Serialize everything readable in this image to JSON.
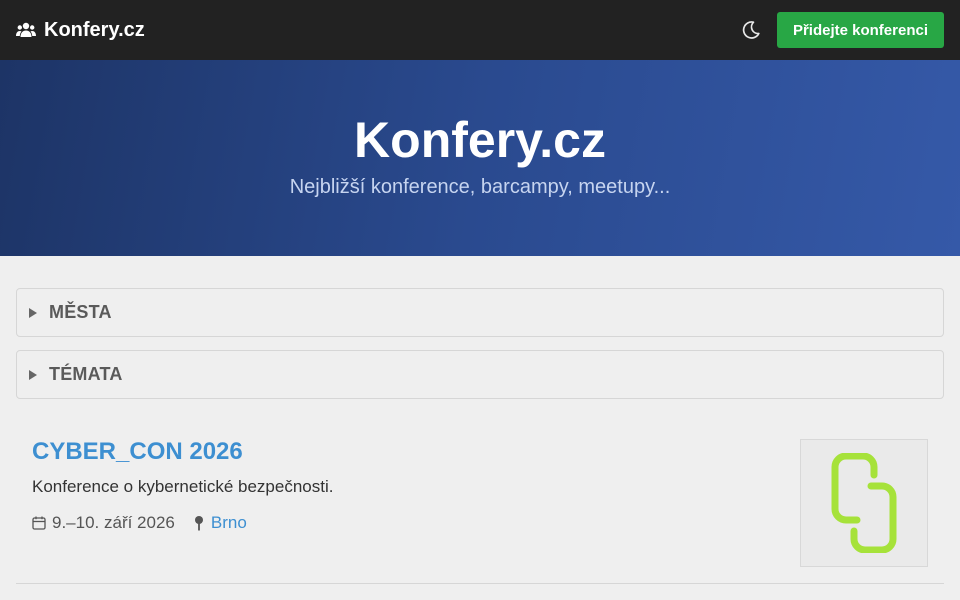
{
  "navbar": {
    "brand_icon": "users-icon",
    "brand": "Konfery.cz",
    "theme_icon": "moon-icon",
    "add_button": "Přidejte konferenci"
  },
  "hero": {
    "title": "Konfery.cz",
    "subtitle": "Nejbližší konference, barcampy, meetupy..."
  },
  "filters": [
    {
      "label": "MĚSTA",
      "icon": "triangle-right-icon"
    },
    {
      "label": "TÉMATA",
      "icon": "triangle-right-icon"
    }
  ],
  "events": [
    {
      "title": "CYBER_CON 2026",
      "description": "Konference o kybernetické bezpečnosti.",
      "date_icon": "calendar-icon",
      "date": "9.–10. září 2026",
      "location_icon": "map-pin-icon",
      "city": "Brno",
      "logo_icon": "chain-logo-icon"
    }
  ],
  "colors": {
    "navbar": "#222222",
    "accent_green": "#28a745",
    "hero_start": "#1d3466",
    "hero_end": "#3559a8",
    "link_blue": "#3d8fd1",
    "logo_green": "#a6e23a",
    "background": "#efefef"
  }
}
